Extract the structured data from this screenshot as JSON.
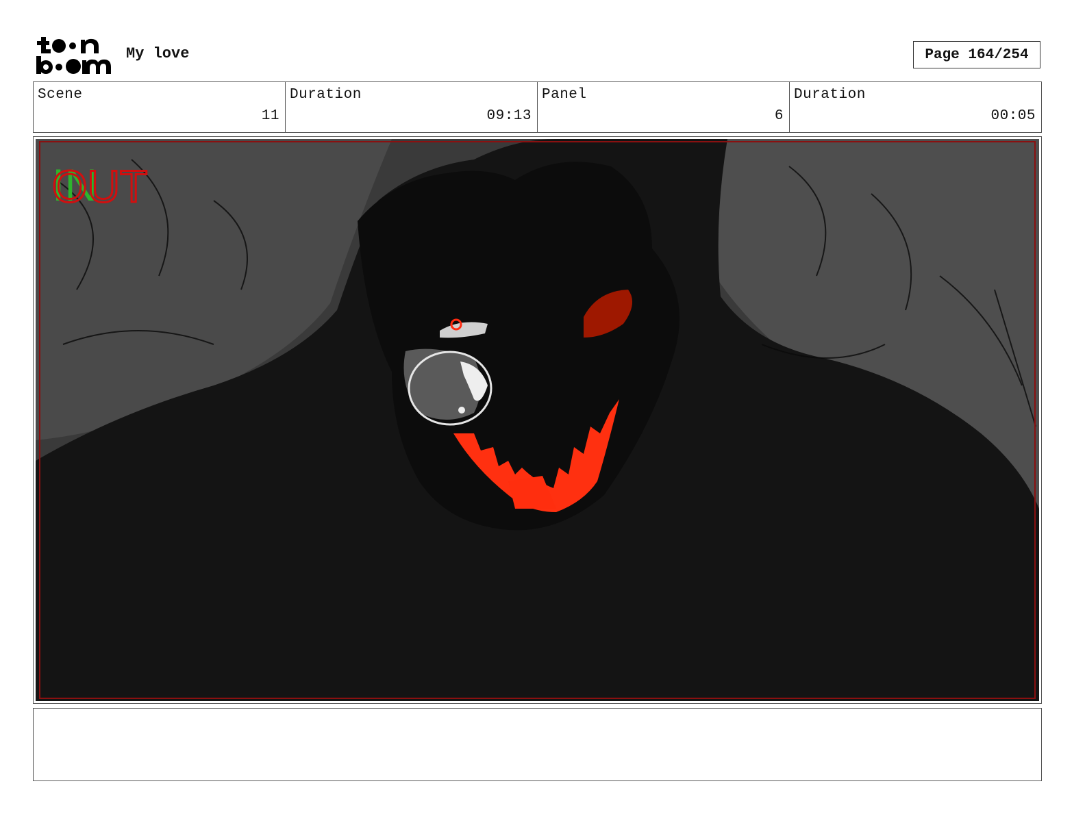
{
  "header": {
    "project_title": "My love",
    "page_label": "Page 164/254"
  },
  "info": {
    "scene_label": "Scene",
    "scene_value": "11",
    "scene_duration_label": "Duration",
    "scene_duration_value": "09:13",
    "panel_label": "Panel",
    "panel_value": "6",
    "panel_duration_label": "Duration",
    "panel_duration_value": "00:05"
  },
  "panel": {
    "in_label": "IN",
    "out_label": "OUT"
  },
  "colors": {
    "in_marker": "#2db52d",
    "out_marker": "#d10f0f",
    "frame_line": "#8a1010",
    "glow": "#ff3010"
  }
}
